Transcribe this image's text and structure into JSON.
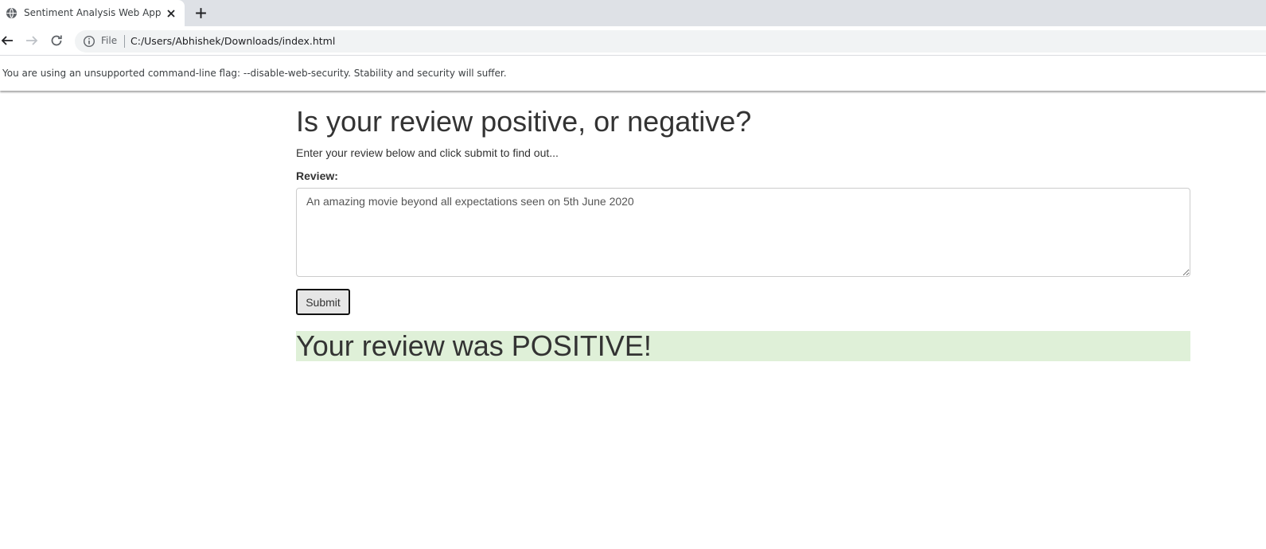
{
  "browser": {
    "tab_title": "Sentiment Analysis Web App",
    "scheme_label": "File",
    "url": "C:/Users/Abhishek/Downloads/index.html",
    "infobar_message": "You are using an unsupported command-line flag: --disable-web-security. Stability and security will suffer."
  },
  "page": {
    "heading": "Is your review positive, or negative?",
    "subtext": "Enter your review below and click submit to find out...",
    "review_label": "Review:",
    "review_value": "An amazing movie beyond all expectations seen on 5th June 2020",
    "submit_label": "Submit",
    "result_text": "Your review was POSITIVE!",
    "result_color": "#dff0d8"
  },
  "icons": {
    "favicon": "globe-icon",
    "tab_close": "close-icon",
    "new_tab": "plus-icon",
    "back": "arrow-left-icon",
    "forward": "arrow-right-icon",
    "reload": "reload-icon",
    "site_info": "info-icon"
  }
}
